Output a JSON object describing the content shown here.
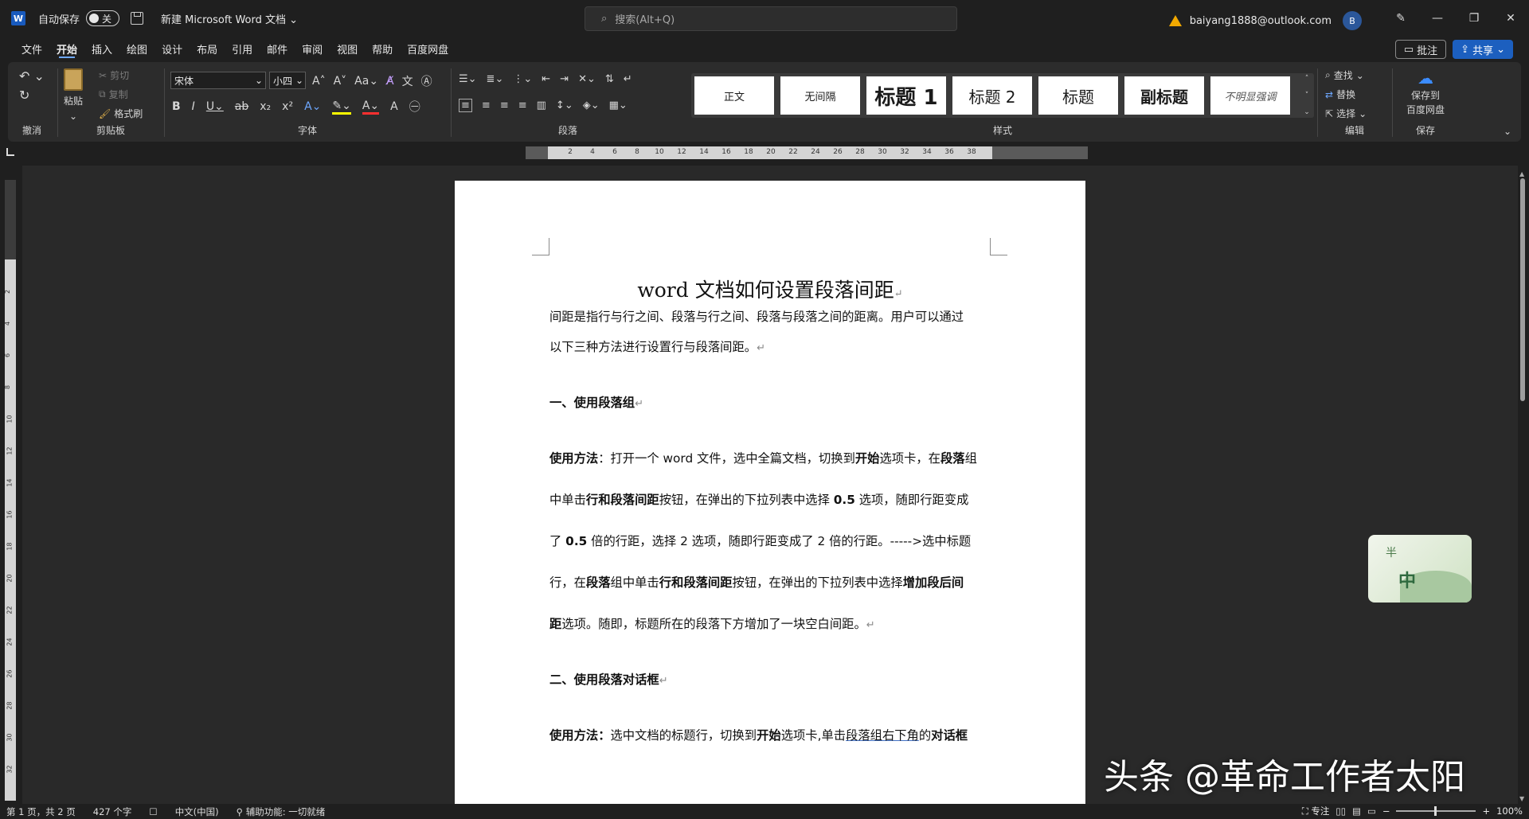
{
  "titlebar": {
    "logo": "W",
    "autosave_label": "自动保存",
    "toggle_state": "关",
    "doc_title": "新建 Microsoft Word 文档",
    "search_placeholder": "搜索(Alt+Q)",
    "account_email": "baiyang1888@outlook.com",
    "avatar_initial": "B"
  },
  "tabs": [
    "文件",
    "开始",
    "插入",
    "绘图",
    "设计",
    "布局",
    "引用",
    "邮件",
    "审阅",
    "视图",
    "帮助",
    "百度网盘"
  ],
  "active_tab": "开始",
  "actions": {
    "comment": "批注",
    "share": "共享"
  },
  "ribbon": {
    "undo_group": "撤消",
    "clipboard": {
      "label": "剪贴板",
      "paste": "粘贴",
      "cut": "剪切",
      "copy": "复制",
      "format_painter": "格式刷"
    },
    "font": {
      "label": "字体",
      "font_name": "宋体",
      "font_size": "小四"
    },
    "paragraph": {
      "label": "段落"
    },
    "styles": {
      "label": "样式",
      "items": [
        "正文",
        "无间隔",
        "标题 1",
        "标题 2",
        "标题",
        "副标题",
        "不明显强调"
      ]
    },
    "editing": {
      "label": "编辑",
      "find": "查找",
      "replace": "替换",
      "select": "选择"
    },
    "save": {
      "label": "保存",
      "save_to": "保存到",
      "baidu": "百度网盘"
    }
  },
  "ruler_ticks": [
    "2",
    "4",
    "6",
    "8",
    "10",
    "12",
    "14",
    "16",
    "18",
    "20",
    "22",
    "24",
    "26",
    "28",
    "30",
    "32",
    "34",
    "36",
    "38"
  ],
  "vruler_ticks": [
    "2",
    "4",
    "6",
    "8",
    "10",
    "12",
    "14",
    "16",
    "18",
    "20",
    "22",
    "24",
    "26",
    "28",
    "30",
    "32"
  ],
  "document": {
    "title": "word 文档如何设置段落间距",
    "p1_line1": "间距是指行与行之间、段落与行之间、段落与段落之间的距离。用户可以通过",
    "p1_line2": "以下三种方法进行设置行与段落间距。",
    "h1": "一、使用段落组",
    "m1_bold": "使用方法",
    "m1_l1a": "：打开一个 word 文件，选中全篇文档，切换到",
    "m1_l1b": "开始",
    "m1_l1c": "选项卡，在",
    "m1_l1d": "段落",
    "m1_l1e": "组",
    "m1_l2a": "中单击",
    "m1_l2b": "行和段落间距",
    "m1_l2c": "按钮，在弹出的下拉列表中选择 ",
    "m1_l2d": "0.5",
    "m1_l2e": " 选项，随即行距变成",
    "m1_l3a": "了 ",
    "m1_l3b": "0.5",
    "m1_l3c": " 倍的行距，选择 2 选项，随即行距变成了 2 倍的行距。----->选中标题",
    "m1_l4a": "行，在",
    "m1_l4b": "段落",
    "m1_l4c": "组中单击",
    "m1_l4d": "行和段落间距",
    "m1_l4e": "按钮，在弹出的下拉列表中选择",
    "m1_l4f": "增加段后间",
    "m1_l5a": "距",
    "m1_l5b": "选项。随即，标题所在的段落下方增加了一块空白间距。",
    "h2": "二、使用段落对话框",
    "m2_bold": "使用方法：",
    "m2_a": "选中文档的标题行，切换到",
    "m2_b": "开始",
    "m2_c": "选项卡,单击",
    "m2_d": "段落组右下角",
    "m2_e": "的",
    "m2_f": "对话框",
    "para_mark": "↵"
  },
  "sticker": {
    "t1": "半",
    "t2": "中"
  },
  "watermark": "头条 @革命工作者太阳",
  "status": {
    "page": "第 1 页，共 2 页",
    "words": "427 个字",
    "lang": "中文(中国)",
    "accessibility": "辅助功能: 一切就绪",
    "focus": "专注",
    "zoom": "100%"
  }
}
